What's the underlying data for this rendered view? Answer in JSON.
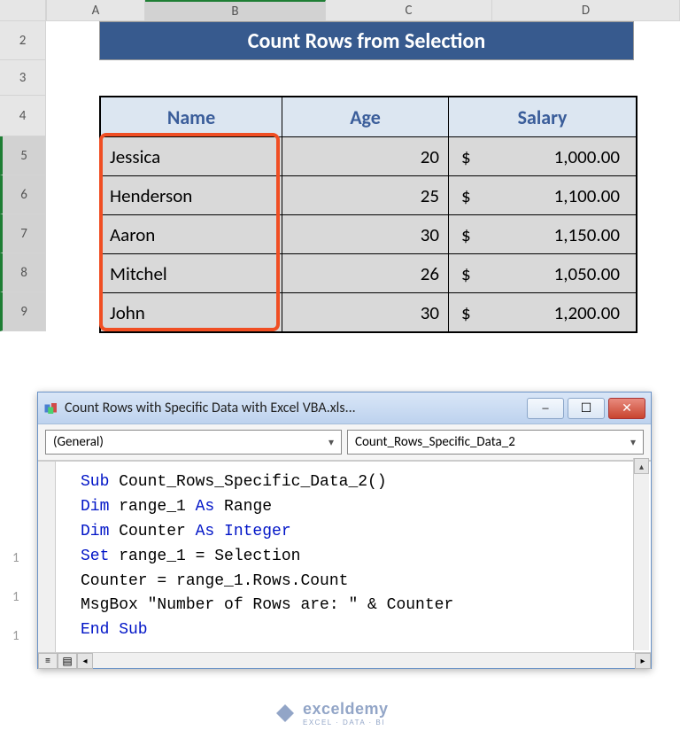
{
  "columns": {
    "A": "A",
    "B": "B",
    "C": "C",
    "D": "D"
  },
  "rows": [
    "2",
    "3",
    "4",
    "5",
    "6",
    "7",
    "8",
    "9"
  ],
  "hidden_rows": [
    "1",
    "1",
    "1"
  ],
  "title": "Count Rows from Selection",
  "headers": {
    "name": "Name",
    "age": "Age",
    "salary": "Salary"
  },
  "data_rows": [
    {
      "name": "Jessica",
      "age": "20",
      "salary": "1,000.00"
    },
    {
      "name": "Henderson",
      "age": "25",
      "salary": "1,100.00"
    },
    {
      "name": "Aaron",
      "age": "30",
      "salary": "1,150.00"
    },
    {
      "name": "Mitchel",
      "age": "26",
      "salary": "1,050.00"
    },
    {
      "name": "John",
      "age": "30",
      "salary": "1,200.00"
    }
  ],
  "currency": "$",
  "vba": {
    "title": "Count Rows with Specific Data with Excel VBA.xls...",
    "dd_left": "(General)",
    "dd_right": "Count_Rows_Specific_Data_2",
    "code_tokens": [
      {
        "w": "Sub",
        "kw": 1
      },
      {
        "w": " Count_Rows_Specific_Data_2()"
      },
      "\n",
      {
        "w": "Dim",
        "kw": 1
      },
      {
        "w": " range_1 "
      },
      {
        "w": "As",
        "kw": 1
      },
      {
        "w": " Range"
      },
      "\n",
      {
        "w": "Dim",
        "kw": 1
      },
      {
        "w": " Counter "
      },
      {
        "w": "As Integer",
        "kw": 1
      },
      "\n",
      {
        "w": "Set",
        "kw": 1
      },
      {
        "w": " range_1 = Selection"
      },
      "\n",
      {
        "w": "Counter = range_1.Rows.Count"
      },
      "\n",
      {
        "w": "MsgBox \"Number of Rows are: \" & Counter"
      },
      "\n",
      {
        "w": "End Sub",
        "kw": 1
      }
    ]
  },
  "watermark": {
    "brand": "exceldemy",
    "sub": "EXCEL · DATA · BI"
  }
}
